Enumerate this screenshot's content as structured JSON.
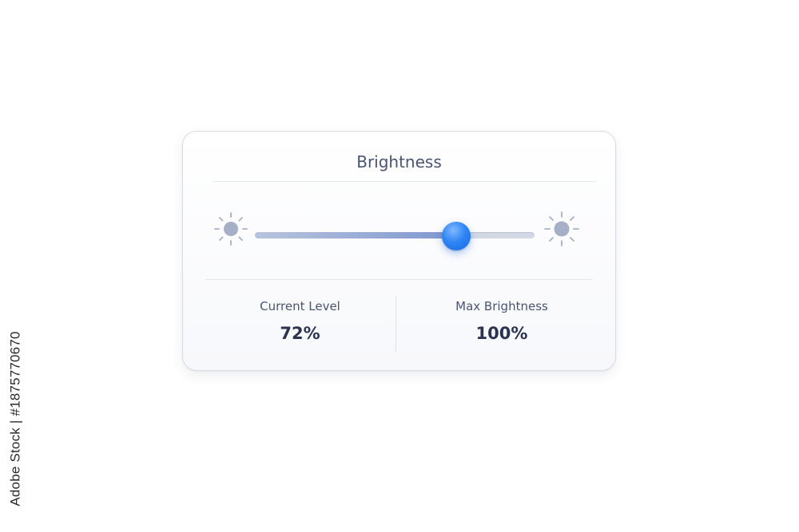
{
  "watermark": {
    "text": "Adobe Stock | #1875770670"
  },
  "panel": {
    "title": "Brightness",
    "icons": {
      "low": "sun-low-icon",
      "high": "sun-high-icon"
    },
    "slider": {
      "value_percent": 72,
      "accent_color": "#2f86f5"
    },
    "stats": [
      {
        "label": "Current Level",
        "value": "72%"
      },
      {
        "label": "Max Brightness",
        "value": "100%"
      }
    ]
  }
}
